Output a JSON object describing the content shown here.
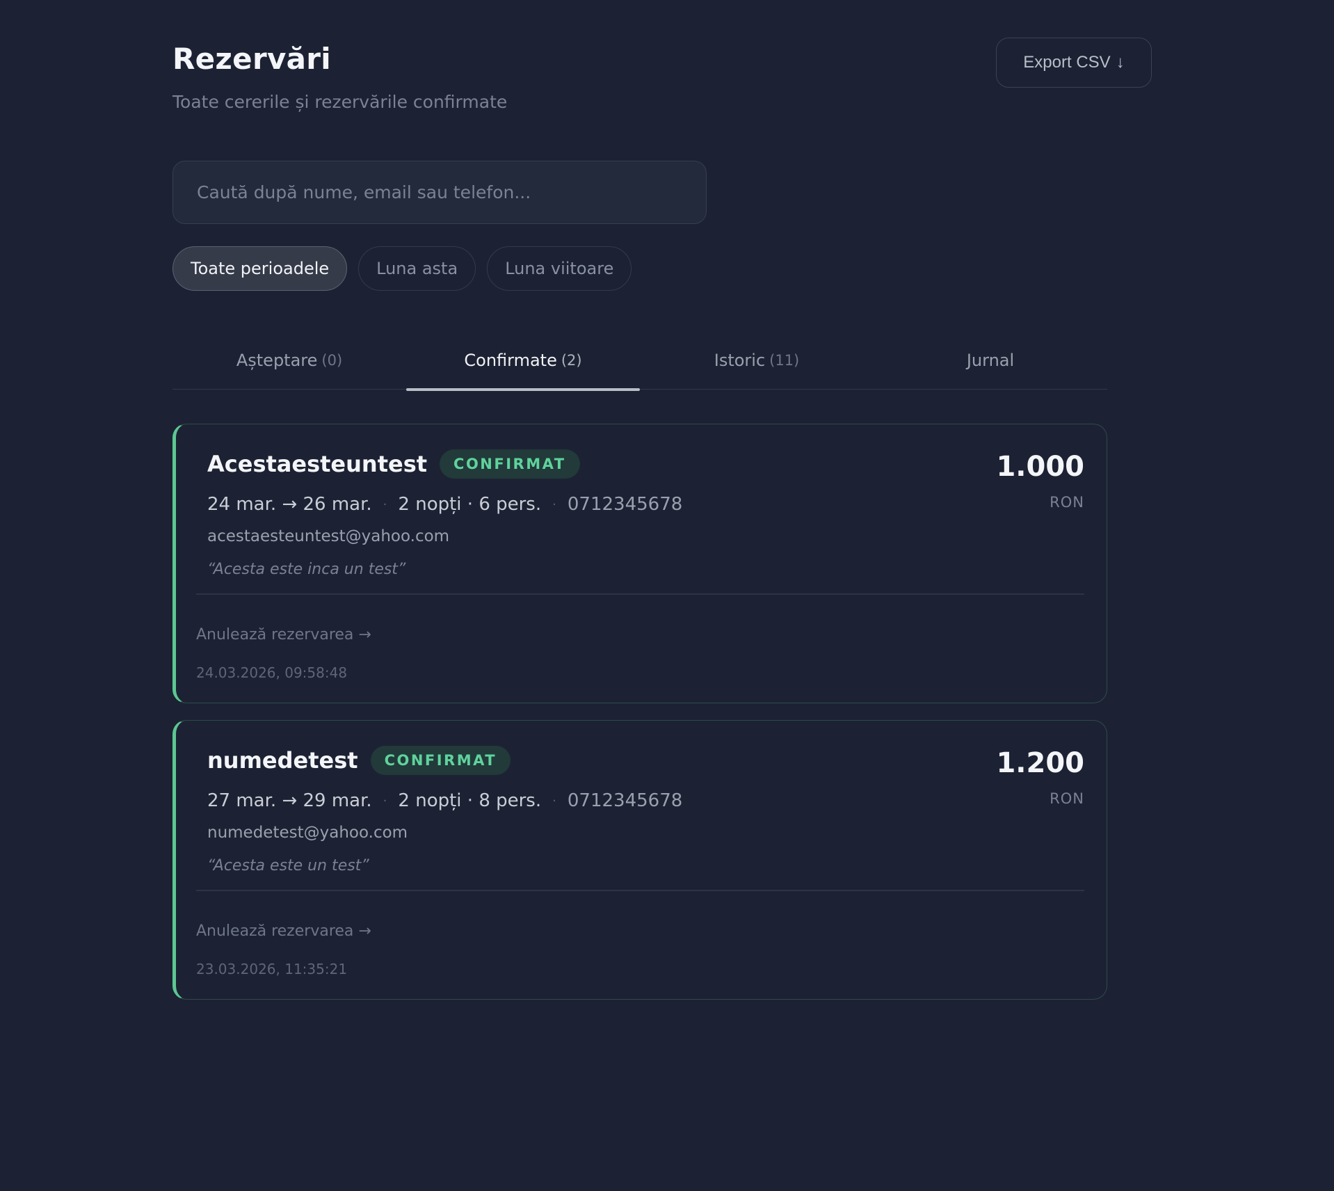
{
  "header": {
    "title": "Rezervări",
    "subtitle": "Toate cererile și rezervările confirmate",
    "export_label": "Export CSV",
    "export_icon": "↓"
  },
  "search": {
    "placeholder": "Caută după nume, email sau telefon..."
  },
  "filters": [
    "Toate perioadele",
    "Luna asta",
    "Luna viitoare"
  ],
  "active_filter": "Toate perioadele",
  "tabs": [
    {
      "label": "Așteptare",
      "count": "(0)"
    },
    {
      "label": "Confirmate",
      "count": "(2)"
    },
    {
      "label": "Istoric",
      "count": "(11)"
    },
    {
      "label": "Jurnal",
      "count": ""
    }
  ],
  "active_tab": "Confirmate",
  "colors": {
    "accent_green": "#5cc792",
    "badge_text": "#5fd39d",
    "background": "#1c2233"
  },
  "bookings": [
    {
      "name": "Acestaesteuntest",
      "status": "CONFIRMAT",
      "dates": "24 mar. → 26 mar.",
      "nights_people": "2 nopți · 6 pers.",
      "phone": "0712345678",
      "email": "acestaesteuntest@yahoo.com",
      "note": "“Acesta este inca un test”",
      "price": "1.000",
      "currency": "RON",
      "cancel_label": "Anulează rezervarea →",
      "timestamp": "24.03.2026, 09:58:48"
    },
    {
      "name": "numedetest",
      "status": "CONFIRMAT",
      "dates": "27 mar. → 29 mar.",
      "nights_people": "2 nopți · 8 pers.",
      "phone": "0712345678",
      "email": "numedetest@yahoo.com",
      "note": "“Acesta este un test”",
      "price": "1.200",
      "currency": "RON",
      "cancel_label": "Anulează rezervarea →",
      "timestamp": "23.03.2026, 11:35:21"
    }
  ]
}
